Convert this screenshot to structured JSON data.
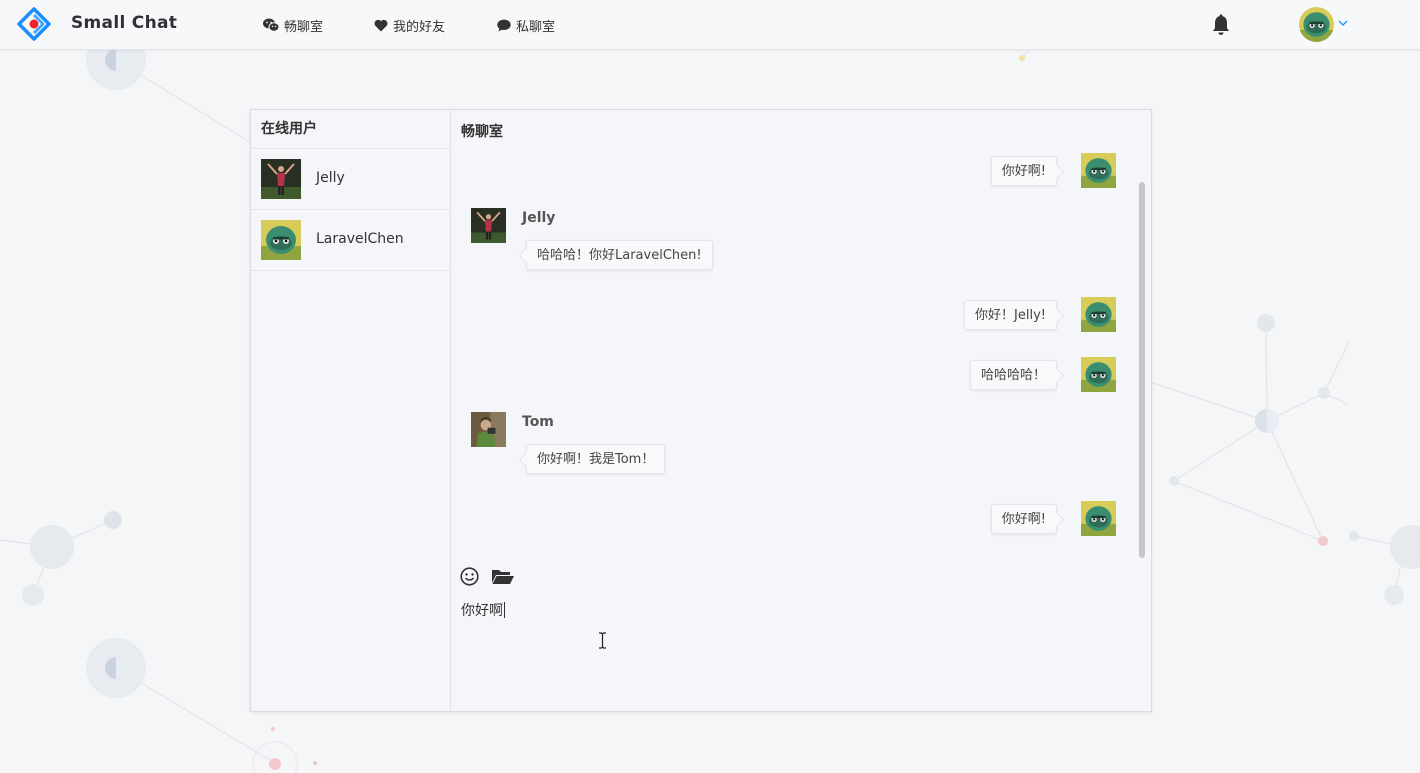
{
  "app": {
    "brand": "Small Chat"
  },
  "nav": {
    "items": [
      {
        "label": "畅聊室",
        "icon": "wechat-icon"
      },
      {
        "label": "我的好友",
        "icon": "heart-icon"
      },
      {
        "label": "私聊室",
        "icon": "comment-icon"
      }
    ]
  },
  "header": {
    "bell_icon": "bell-icon",
    "user_menu_icon": "chevron-down-icon"
  },
  "sidebar": {
    "title": "在线用户",
    "users": [
      {
        "name": "Jelly"
      },
      {
        "name": "LaravelChen"
      }
    ]
  },
  "chat": {
    "title": "畅聊室",
    "messages": [
      {
        "side": "right",
        "text": "你好啊!"
      },
      {
        "side": "left",
        "name": "Jelly",
        "text": "哈哈哈！你好LaravelChen!"
      },
      {
        "side": "right",
        "text": "你好！Jelly!"
      },
      {
        "side": "right",
        "text": "哈哈哈哈！"
      },
      {
        "side": "left",
        "name": "Tom",
        "text": "你好啊！我是Tom！"
      },
      {
        "side": "right",
        "text": "你好啊!"
      }
    ],
    "toolbar": {
      "emoji_icon": "smile-icon",
      "file_icon": "folder-open-icon"
    },
    "input_value": "你好啊"
  },
  "colors": {
    "accent": "#1890ff",
    "logo_red": "#f5222d",
    "text": "#333333",
    "panel_bg": "#f5f6f9"
  }
}
